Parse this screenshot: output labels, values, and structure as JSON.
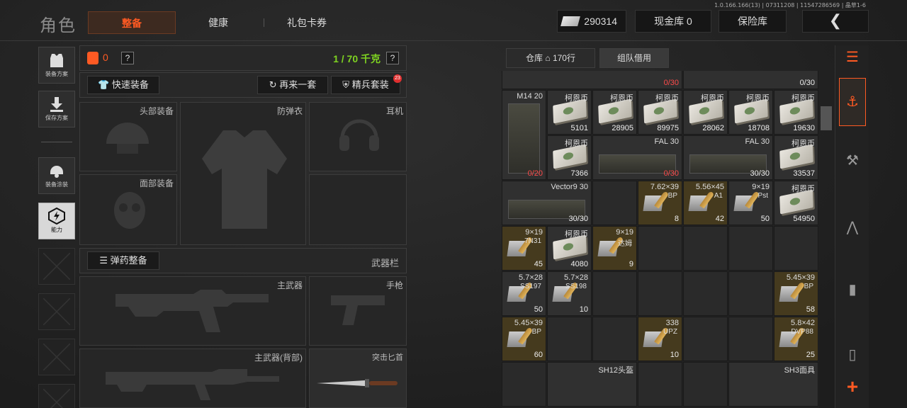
{
  "header": {
    "title": "角色",
    "tabs": [
      {
        "label": "整备",
        "active": true
      },
      {
        "label": "健康"
      },
      {
        "label": "礼包卡券"
      }
    ],
    "version": "1.0.166.166(13) | 07311208 | 11547286569 | 晶草1-6",
    "currency_value": "290314",
    "cash_vault": "现金库 0",
    "insurance": "保险库",
    "accent": "#ff5a23"
  },
  "sidebar": {
    "items": [
      {
        "label": "装备方案",
        "icon": "vest-icon"
      },
      {
        "label": "保存方案",
        "icon": "download-icon"
      },
      {
        "label": "装备涂装",
        "icon": "helmet-paint-icon"
      },
      {
        "label": "能力",
        "icon": "ability-icon"
      }
    ]
  },
  "equipment": {
    "armor_count": "0",
    "weight": "1 / 70 千克",
    "quick_equip": "快速装备",
    "again": "再来一套",
    "elite": "精兵套装",
    "elite_badge": "23",
    "slots": {
      "head": "头部装备",
      "armor": "防弹衣",
      "headset": "耳机",
      "face": "面部装备"
    },
    "ammo_equip": "弹药整备",
    "weapon_bar": "武器栏",
    "primary": "主武器",
    "pistol": "手枪",
    "primary_back": "主武器(背部)",
    "knife": "突击匕首"
  },
  "warehouse": {
    "tab_label": "仓库",
    "rows": "170行",
    "team": "组队借用",
    "cells": [
      {
        "c": 0,
        "r": -1,
        "w": 4,
        "name": "",
        "qty": "0/30",
        "red": true,
        "kind": "item"
      },
      {
        "c": 4,
        "r": -1,
        "w": 3,
        "name": "",
        "qty": "0/30",
        "kind": "item"
      },
      {
        "c": 0,
        "r": 0,
        "h": 2,
        "name": "M14 20",
        "qty": "0/20",
        "red": true,
        "kind": "mag"
      },
      {
        "c": 1,
        "r": 0,
        "name": "柯恩币",
        "qty": "5101",
        "kind": "cash"
      },
      {
        "c": 2,
        "r": 0,
        "name": "柯恩币",
        "qty": "28905",
        "kind": "cash"
      },
      {
        "c": 3,
        "r": 0,
        "name": "柯恩币",
        "qty": "89975",
        "kind": "cash"
      },
      {
        "c": 4,
        "r": 0,
        "name": "柯恩币",
        "qty": "28062",
        "kind": "cash"
      },
      {
        "c": 5,
        "r": 0,
        "name": "柯恩币",
        "qty": "18708",
        "kind": "cash"
      },
      {
        "c": 6,
        "r": 0,
        "name": "柯恩币",
        "qty": "19630",
        "kind": "cash"
      },
      {
        "c": 1,
        "r": 1,
        "name": "柯恩币",
        "qty": "7366",
        "kind": "cash"
      },
      {
        "c": 2,
        "r": 1,
        "w": 2,
        "name": "FAL 30",
        "qty": "0/30",
        "red": true,
        "kind": "mag"
      },
      {
        "c": 4,
        "r": 1,
        "w": 2,
        "name": "FAL 30",
        "qty": "30/30",
        "kind": "mag"
      },
      {
        "c": 6,
        "r": 1,
        "name": "柯恩币",
        "qty": "33537",
        "kind": "cash"
      },
      {
        "c": 0,
        "r": 2,
        "w": 2,
        "name": "Vector9 30",
        "qty": "30/30",
        "kind": "mag"
      },
      {
        "c": 3,
        "r": 2,
        "name": "7.62×39",
        "sub": "BP",
        "qty": "8",
        "kind": "ammo"
      },
      {
        "c": 4,
        "r": 2,
        "name": "5.56×45",
        "sub": "A1",
        "qty": "42",
        "kind": "ammo"
      },
      {
        "c": 5,
        "r": 2,
        "name": "9×19",
        "sub": "Pst",
        "qty": "50",
        "kind": "ammo2"
      },
      {
        "c": 6,
        "r": 2,
        "name": "柯恩币",
        "qty": "54950",
        "kind": "cash"
      },
      {
        "c": 0,
        "r": 3,
        "name": "9×19",
        "sub": "7N31",
        "qty": "45",
        "kind": "ammo"
      },
      {
        "c": 1,
        "r": 3,
        "name": "柯恩币",
        "qty": "4080",
        "kind": "cash"
      },
      {
        "c": 2,
        "r": 3,
        "name": "9×19",
        "sub": "达姆",
        "qty": "9",
        "kind": "ammo"
      },
      {
        "c": 0,
        "r": 4,
        "name": "5.7×28",
        "sub": "SS197",
        "qty": "50",
        "kind": "ammo2"
      },
      {
        "c": 1,
        "r": 4,
        "name": "5.7×28",
        "sub": "SS198",
        "qty": "10",
        "kind": "ammo2"
      },
      {
        "c": 6,
        "r": 4,
        "name": "5.45×39",
        "sub": "BP",
        "qty": "58",
        "kind": "ammo"
      },
      {
        "c": 0,
        "r": 5,
        "name": "5.45×39",
        "sub": "BP",
        "qty": "60",
        "kind": "ammo"
      },
      {
        "c": 3,
        "r": 5,
        "name": "338",
        "sub": "UPZ",
        "qty": "10",
        "kind": "ammo"
      },
      {
        "c": 6,
        "r": 5,
        "name": "5.8×42",
        "sub": "DVP88",
        "qty": "25",
        "kind": "ammo"
      },
      {
        "c": 1,
        "r": 6,
        "w": 2,
        "name": "SH12头盔",
        "qty": "",
        "kind": "item"
      },
      {
        "c": 5,
        "r": 6,
        "w": 2,
        "name": "SH3面具",
        "qty": "",
        "kind": "item"
      }
    ]
  },
  "right_tools": [
    "stack-icon",
    "helmet-icon",
    "backpack-icon",
    "rifle-icon",
    "magazine-icon",
    "bullet-icon",
    "add-icon"
  ]
}
